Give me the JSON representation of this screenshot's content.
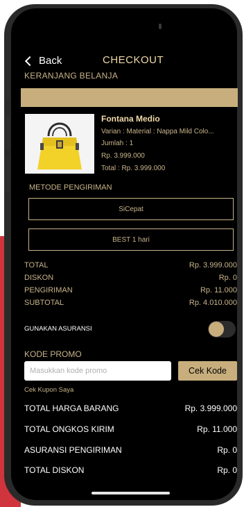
{
  "header": {
    "back_label": "Back",
    "title": "CHECKOUT"
  },
  "cart": {
    "section_title": "KERANJANG BELANJA"
  },
  "product": {
    "name": "Fontana Medio",
    "variant": "Varian : Material : Nappa Mild  Colo...",
    "quantity": "Jumlah : 1",
    "price": "Rp. 3.999.000",
    "total": "Total : Rp. 3.999.000"
  },
  "shipping": {
    "section_title": "METODE PENGIRIMAN",
    "courier": "SiCepat",
    "service": "BEST 1 hari"
  },
  "summary": [
    {
      "label": "TOTAL",
      "value": "Rp. 3.999.000"
    },
    {
      "label": "DISKON",
      "value": "Rp. 0"
    },
    {
      "label": "PENGIRIMAN",
      "value": "Rp. 11.000"
    },
    {
      "label": "SUBTOTAL",
      "value": "Rp. 4.010.000"
    }
  ],
  "insurance": {
    "label": "GUNAKAN ASURANSI",
    "enabled": true
  },
  "promo": {
    "label": "KODE PROMO",
    "placeholder": "Masukkan kode promo",
    "button": "Cek Kode",
    "coupon_link": "Cek Kupon Saya"
  },
  "totals": [
    {
      "label": "TOTAL HARGA BARANG",
      "value": "Rp. 3.999.000"
    },
    {
      "label": "TOTAL ONGKOS KIRIM",
      "value": "Rp. 11.000"
    },
    {
      "label": "ASURANSI PENGIRIMAN",
      "value": "Rp. 0"
    },
    {
      "label": "TOTAL DISKON",
      "value": "Rp. 0"
    }
  ],
  "colors": {
    "accent_gold": "#c7ae7c",
    "background": "#000000",
    "brand_red": "#d0343c"
  }
}
